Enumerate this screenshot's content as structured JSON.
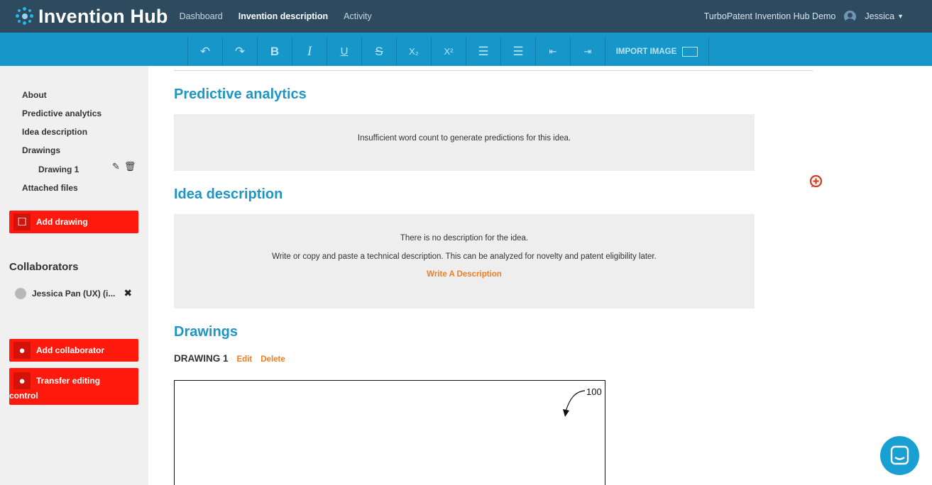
{
  "header": {
    "app_name": "Invention Hub",
    "nav": [
      "Dashboard",
      "Invention description",
      "Activity"
    ],
    "org": "TurboPatent Invention Hub Demo",
    "user": "Jessica"
  },
  "toolbar": {
    "buttons": [
      "↶",
      "↷",
      "B",
      "I",
      "U",
      "S",
      "X₂",
      "X²",
      "☰",
      "☰",
      "⇤",
      "⇥"
    ],
    "import_label": "IMPORT IMAGE"
  },
  "sidebar": {
    "links": [
      "About",
      "Predictive analytics",
      "Idea description",
      "Drawings"
    ],
    "drawing_item": "Drawing 1",
    "attached": "Attached files",
    "add_drawing": "Add drawing",
    "collaborators_title": "Collaborators",
    "collaborator": "Jessica Pan (UX)  (i...",
    "add_collaborator": "Add collaborator",
    "transfer_line1": "Transfer editing",
    "transfer_line2": "control"
  },
  "main": {
    "predictive_title": "Predictive analytics",
    "predictive_msg": "Insufficient word count to generate predictions for this idea.",
    "idea_title": "Idea description",
    "idea_msg1": "There is no description for the idea.",
    "idea_msg2": "Write or copy and paste a technical description. This can be analyzed for novelty and patent eligibility later.",
    "idea_link": "Write A Description",
    "drawings_title": "Drawings",
    "drawing_label": "DRAWING 1",
    "drawing_edit": "Edit",
    "drawing_delete": "Delete",
    "drawing_ref": "100"
  },
  "colors": {
    "topbar": "#2e4a5e",
    "toolbar": "#1696c9",
    "accent_blue": "#1f95c5",
    "red": "#ff1a0d",
    "orange": "#f07e22"
  }
}
